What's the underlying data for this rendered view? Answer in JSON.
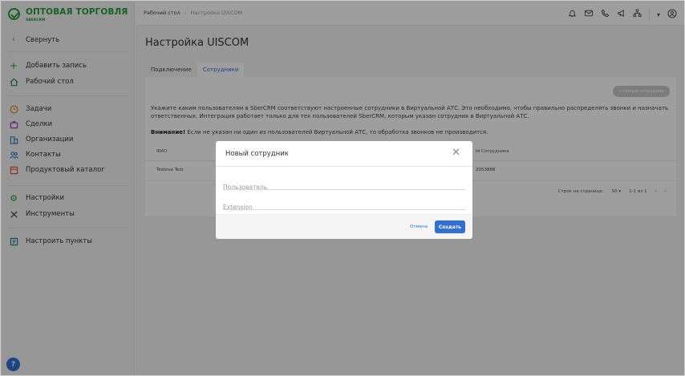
{
  "colors": {
    "brand": "#21a038",
    "accent": "#2f6fd6"
  },
  "brand": {
    "title": "ОПТОВАЯ ТОРГОВЛЯ",
    "subtitle": "SBERCRM"
  },
  "sidebar": {
    "collapse": {
      "label": "Свернуть",
      "icon": "chevron-left-icon"
    },
    "items": [
      {
        "label": "Добавить запись",
        "icon": "plus-icon"
      },
      {
        "label": "Рабочий стол",
        "icon": "home-icon"
      },
      {
        "label": "Задачи",
        "icon": "clock-icon"
      },
      {
        "label": "Сделки",
        "icon": "briefcase-icon"
      },
      {
        "label": "Организации",
        "icon": "building-icon"
      },
      {
        "label": "Контакты",
        "icon": "people-icon"
      },
      {
        "label": "Продуктовый каталог",
        "icon": "catalog-icon"
      },
      {
        "label": "Настройки",
        "icon": "gear-icon"
      },
      {
        "label": "Инструменты",
        "icon": "tools-icon"
      },
      {
        "label": "Настроить пункты",
        "icon": "customize-icon"
      }
    ],
    "help": "?"
  },
  "breadcrumb": {
    "home": "Рабочий стол",
    "current": "Настройка UISCOM"
  },
  "page": {
    "title": "Настройка UISCOM",
    "tabs": [
      {
        "label": "Подключение"
      },
      {
        "label": "Сотрудники"
      }
    ],
    "new_employee_button": "+ Новый сотрудник",
    "description": "Укажите каким пользователям в SberCRM соответствуют настроенные сотрудники в Виртуальной АТС. Это необходимо, чтобы правильно распределять звонки и назначать ответственных. Интеграция работает только для тех пользователей SberCRM, которым указан сотрудник в Виртуальной АТС.",
    "warning_bold": "Внимание!",
    "warning_text": " Если не указан ни один из пользователей Виртуальной АТС, то обработка звонков не производится.",
    "table": {
      "columns": [
        "ФИО",
        "Id Сотрудника"
      ],
      "rows": [
        {
          "name": "Testova Test",
          "id": "2053888"
        }
      ]
    },
    "pagination": {
      "rows_label": "Строк на странице:",
      "rows_value": "50 ▾",
      "range": "1-1 из 1"
    }
  },
  "modal": {
    "title": "Новый сотрудник",
    "user_placeholder": "Пользователь",
    "extension_placeholder": "Extension",
    "cancel": "Отмена",
    "create": "Создать"
  }
}
